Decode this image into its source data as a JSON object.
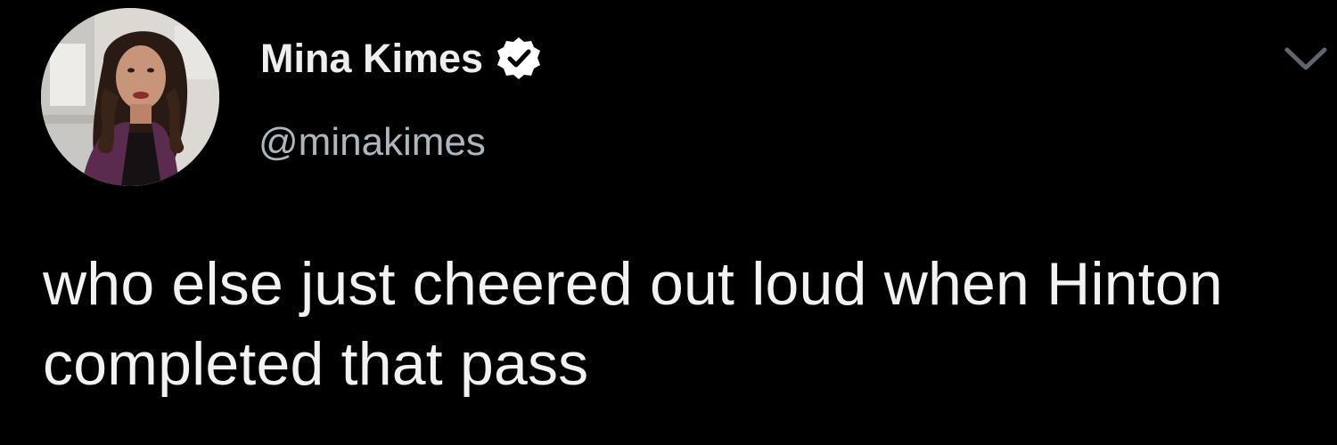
{
  "tweet": {
    "author": {
      "display_name": "Mina Kimes",
      "handle": "@minakimes",
      "verified": true
    },
    "text": "who else just cheered out loud when Hinton completed that pass",
    "menu_icon": "chevron-down-icon",
    "avatar_icon": "profile-photo"
  },
  "colors": {
    "background": "#000000",
    "name_text": "#eeeeee",
    "handle_text": "#aeb6bd",
    "body_text": "#f2f2f2",
    "verified_badge": "#ffffff"
  }
}
